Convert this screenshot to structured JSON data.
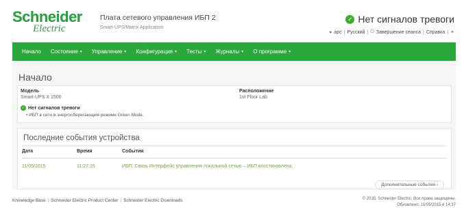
{
  "header": {
    "logo_word1": "Schneider",
    "logo_word2": "Electric",
    "app_title": "Плата сетевого управления ИБП 2",
    "app_subtitle": "Smart-UPS/Matrix Application",
    "alarm_status": "Нет сигналов тревоги",
    "links": {
      "apc": "apc",
      "language": "Русский",
      "logout": "Завершение сеанса",
      "help": "Справка"
    }
  },
  "nav": {
    "items": [
      "Начало",
      "Состояние",
      "Управление",
      "Конфигурация",
      "Тесты",
      "Журналы",
      "О программе"
    ]
  },
  "main": {
    "title": "Начало",
    "model_label": "Модель",
    "model_value": "Smart-UPS X 1500",
    "location_label": "Расположение",
    "location_value": "1st Floor Lab",
    "status_label": "Нет сигналов тревоги",
    "status_detail": "ИБП в сети в энергосберегающем режиме Green Mode."
  },
  "events": {
    "title": "Последние события устройства",
    "columns": [
      "Дата",
      "Время",
      "События"
    ],
    "rows": [
      {
        "date": "11/05/2015",
        "time": "11:27:16",
        "event": "ИБП: Связь Интерфейс управления локальной сетью – ИБП восстановлена."
      }
    ],
    "more_button": "Дополнительные события"
  },
  "footer": {
    "links": [
      "Knowledge Base",
      "Schneider Electric Product Center",
      "Schneider Electric Downloads"
    ],
    "copyright": "© 2015, Schneider Electric. Все права защищены.",
    "updated": "Обновлено: 11/05/2015 в 14:37"
  },
  "colors": {
    "brand_green": "#2aa83b",
    "status_green": "#3dae2b",
    "event_text": "#7aa34a"
  }
}
